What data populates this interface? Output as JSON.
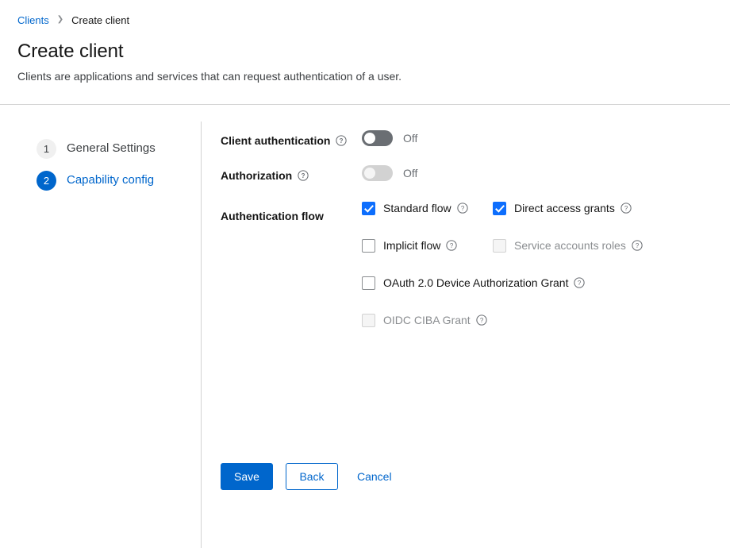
{
  "breadcrumb": {
    "root_label": "Clients",
    "separator": "❯",
    "current_label": "Create client"
  },
  "header": {
    "title": "Create client",
    "subtitle": "Clients are applications and services that can request authentication of a user."
  },
  "wizard": {
    "steps": [
      {
        "number": "1",
        "label": "General Settings",
        "active": false
      },
      {
        "number": "2",
        "label": "Capability config",
        "active": true
      }
    ]
  },
  "form": {
    "client_authentication": {
      "label": "Client authentication",
      "help_icon": "help-circle-icon",
      "state_label": "Off",
      "enabled": true
    },
    "authorization": {
      "label": "Authorization",
      "help_icon": "help-circle-icon",
      "state_label": "Off",
      "enabled": false
    },
    "authentication_flow": {
      "label": "Authentication flow",
      "options": [
        {
          "label": "Standard flow",
          "checked": true,
          "disabled": false,
          "help_icon": "help-circle-icon"
        },
        {
          "label": "Direct access grants",
          "checked": true,
          "disabled": false,
          "help_icon": "help-circle-icon"
        },
        {
          "label": "Implicit flow",
          "checked": false,
          "disabled": false,
          "help_icon": "help-circle-icon"
        },
        {
          "label": "Service accounts roles",
          "checked": false,
          "disabled": true,
          "help_icon": "help-circle-icon"
        },
        {
          "label": "OAuth 2.0 Device Authorization Grant",
          "checked": false,
          "disabled": false,
          "help_icon": "help-circle-icon"
        },
        {
          "label": "OIDC CIBA Grant",
          "checked": false,
          "disabled": true,
          "help_icon": "help-circle-icon"
        }
      ]
    }
  },
  "actions": {
    "save_label": "Save",
    "back_label": "Back",
    "cancel_label": "Cancel"
  },
  "colors": {
    "accent": "#0066cc",
    "checkbox_checked": "#0d6efd",
    "toggle_off": "#6a6e73",
    "toggle_disabled": "#d2d2d2",
    "text": "#151515",
    "muted_text": "#6a6e73",
    "border": "#d2d2d2"
  }
}
